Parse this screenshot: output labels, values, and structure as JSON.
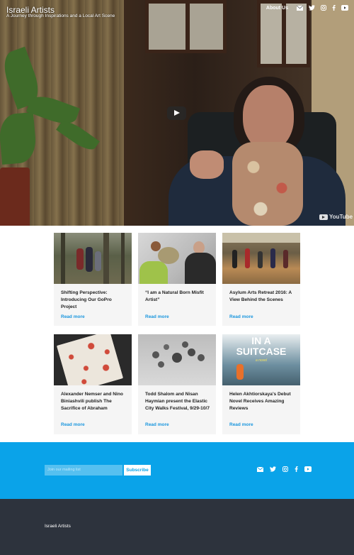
{
  "header": {
    "site_title": "Israeli Artists",
    "tagline": "A Journey through Inspirations and a Local Art Scene",
    "about_label": "About Us",
    "icons": [
      "mail-icon",
      "twitter-icon",
      "instagram-icon",
      "facebook-icon",
      "youtube-icon"
    ]
  },
  "video": {
    "youtube_label": "YouTube"
  },
  "posts": [
    {
      "title": "Shifting Perspective: Introducing Our GoPro Project",
      "more_label": "Read more"
    },
    {
      "title": "“I am a Natural Born Misfit Artist”",
      "more_label": "Read more"
    },
    {
      "title": "Asylum Arts Retreat 2016: A View Behind the Scenes",
      "more_label": "Read more"
    },
    {
      "title": "Alexander Nemser and Nino Biniashvili publish The Sacrifice of Abraham",
      "more_label": "Read more"
    },
    {
      "title": "Todd Shalom and Nisan Haymian present the Elastic City Walks Festival, 9/29-10/7",
      "more_label": "Read more"
    },
    {
      "title": "Helen Akhtiorskaya's Debut Novel Receives Amazing Reviews",
      "more_label": "Read more"
    }
  ],
  "book_cover_text": "IN A SUITCASE",
  "book_cover_small": "a novel",
  "newsletter": {
    "placeholder": "Join our mailing list",
    "button_label": "Subscribe"
  },
  "footer": {
    "copyright": "Israeli Artists"
  },
  "colors": {
    "accent": "#0aa3e9",
    "link": "#1a96de",
    "footer_dark": "#2d333d"
  }
}
